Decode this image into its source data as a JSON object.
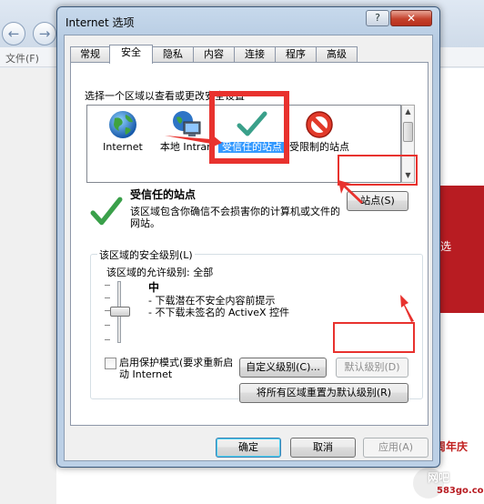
{
  "background": {
    "menu_label": "文件(F)",
    "side_text": "选",
    "anniversary": "周年庆",
    "logo_main": "网吧",
    "logo_url": "583go.com"
  },
  "window": {
    "title": "Internet 选项",
    "help_label": "?",
    "close_label": "✕"
  },
  "tabs": [
    {
      "label": "常规"
    },
    {
      "label": "安全"
    },
    {
      "label": "隐私"
    },
    {
      "label": "内容"
    },
    {
      "label": "连接"
    },
    {
      "label": "程序"
    },
    {
      "label": "高级"
    }
  ],
  "zones": {
    "prompt": "选择一个区域以查看或更改安全设置",
    "items": [
      {
        "label": "Internet",
        "icon": "globe-icon"
      },
      {
        "label": "本地 Intran",
        "icon": "local-intranet-icon"
      },
      {
        "label": "受信任的站点",
        "icon": "checkmark-icon"
      },
      {
        "label": "受限制的站点",
        "icon": "restricted-icon"
      }
    ]
  },
  "selected_zone": {
    "title": "受信任的站点",
    "description": "该区域包含你确信不会损害你的计算机或文件的网站。",
    "sites_button": "站点(S)"
  },
  "security_level": {
    "group_label": "该区域的安全级别(L)",
    "allowed_levels": "该区域的允许级别: 全部",
    "level_name": "中",
    "bullet_1": "- 下载潜在不安全内容前提示",
    "bullet_2": "- 不下载未签名的 ActiveX 控件",
    "protected_mode_label": "启用保护模式(要求重新启动 Internet",
    "custom_level_button": "自定义级别(C)...",
    "default_level_button": "默认级别(D)",
    "reset_all_button": "将所有区域重置为默认级别(R)"
  },
  "footer": {
    "ok": "确定",
    "cancel": "取消",
    "apply": "应用(A)"
  },
  "colors": {
    "selection": "#3399ff",
    "annotation": "#e8322e",
    "check_green": "#3aa04a"
  }
}
